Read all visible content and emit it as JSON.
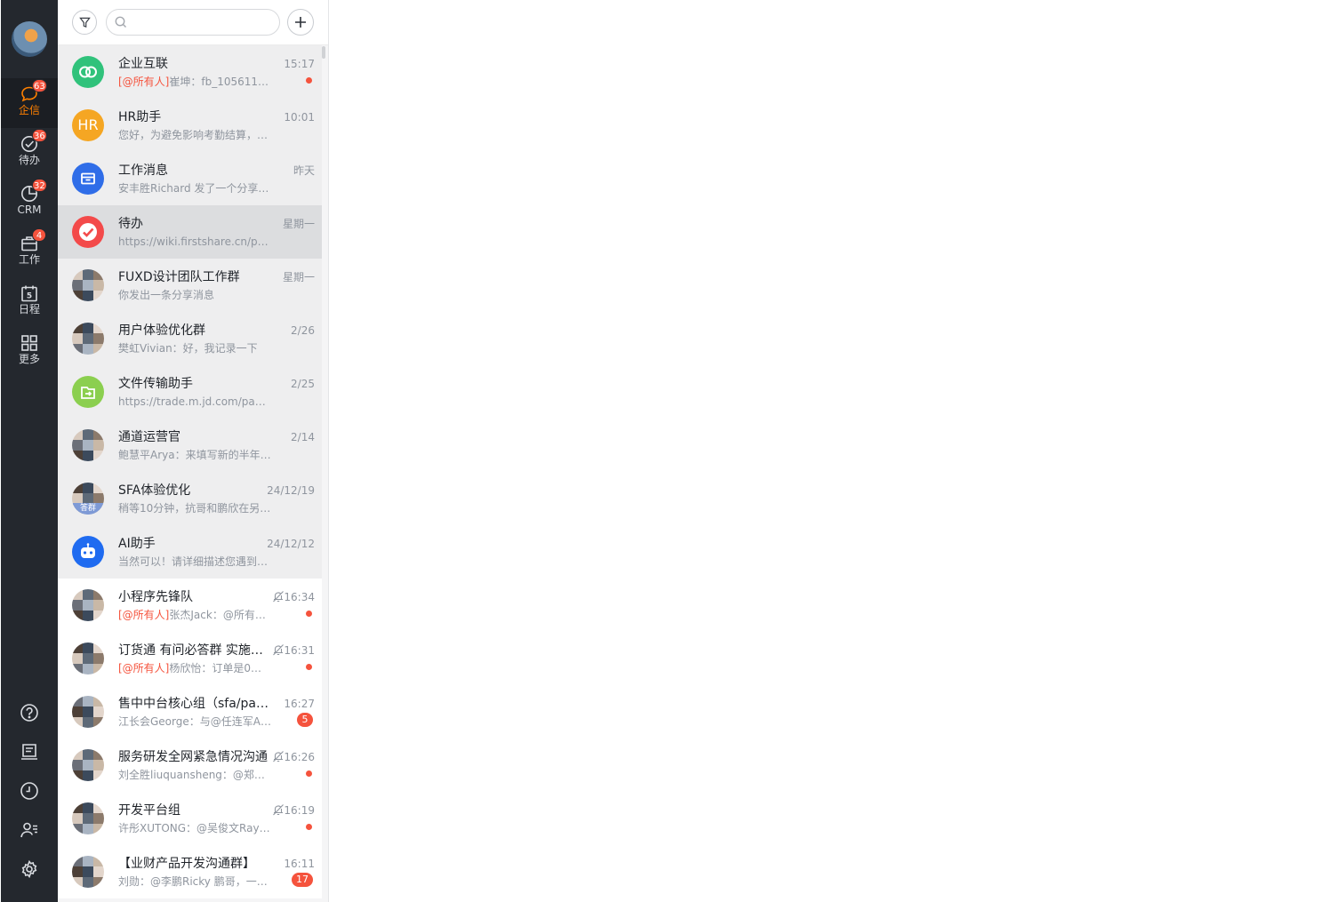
{
  "nav": {
    "items": [
      {
        "label": "企信",
        "badge": "63",
        "icon": "chat-bubble-icon",
        "active": true
      },
      {
        "label": "待办",
        "badge": "36",
        "icon": "check-circle-icon",
        "active": false
      },
      {
        "label": "CRM",
        "badge": "32",
        "icon": "pie-chart-icon",
        "active": false
      },
      {
        "label": "工作",
        "badge": "4",
        "icon": "briefcase-icon",
        "active": false
      },
      {
        "label": "日程",
        "badge": "",
        "icon": "calendar-icon",
        "active": false
      },
      {
        "label": "更多",
        "badge": "",
        "icon": "grid-icon",
        "active": false
      }
    ],
    "calendar_day": "5",
    "bottom_icons": [
      "help-icon",
      "notes-icon",
      "clock-icon",
      "contacts-icon",
      "settings-icon"
    ]
  },
  "search": {
    "placeholder": ""
  },
  "conversations": [
    {
      "name": "企业互联",
      "mention": "[@所有人]",
      "preview": "崔坤：fb_105611…",
      "time": "15:17",
      "dot": true,
      "count": "",
      "muted": false,
      "pinned": true,
      "avatar": "interconnect-icon"
    },
    {
      "name": "HR助手",
      "mention": "",
      "preview": "您好，为避免影响考勤结算，…",
      "time": "10:01",
      "dot": false,
      "count": "",
      "muted": false,
      "pinned": true,
      "avatar_text": "HR"
    },
    {
      "name": "工作消息",
      "mention": "",
      "preview": "安丰胜Richard 发了一个分享…",
      "time": "昨天",
      "dot": false,
      "count": "",
      "muted": false,
      "pinned": true,
      "avatar": "work-message-icon"
    },
    {
      "name": "待办",
      "mention": "",
      "preview": "https://wiki.firstshare.cn/page…",
      "time": "星期一",
      "dot": false,
      "count": "",
      "muted": false,
      "pinned": true,
      "selected": true,
      "avatar": "todo-check-icon"
    },
    {
      "name": "FUXD设计团队工作群",
      "mention": "",
      "preview": "你发出一条分享消息",
      "time": "星期一",
      "dot": false,
      "count": "",
      "muted": false,
      "pinned": true,
      "avatar": "group-mosaic"
    },
    {
      "name": "用户体验优化群",
      "mention": "",
      "preview": "樊虹Vivian：好，我记录一下",
      "time": "2/26",
      "dot": false,
      "count": "",
      "muted": false,
      "pinned": true,
      "avatar": "group-mosaic"
    },
    {
      "name": "文件传输助手",
      "mention": "",
      "preview": "https://trade.m.jd.com/pay?co…",
      "time": "2/25",
      "dot": false,
      "count": "",
      "muted": false,
      "pinned": true,
      "avatar": "file-transfer-icon"
    },
    {
      "name": "通道运营官",
      "mention": "",
      "preview": "鲍慧平Arya：来填写新的半年…",
      "time": "2/14",
      "dot": false,
      "count": "",
      "muted": false,
      "pinned": true,
      "avatar": "group-mosaic"
    },
    {
      "name": "SFA体验优化",
      "mention": "",
      "preview": "稍等10分钟，抗哥和鹏欣在另…",
      "time": "24/12/19",
      "dot": false,
      "count": "",
      "muted": false,
      "pinned": true,
      "avatar": "group-mosaic",
      "avatar_tag": "答群"
    },
    {
      "name": "AI助手",
      "mention": "",
      "preview": "当然可以！请详细描述您遇到…",
      "time": "24/12/12",
      "dot": false,
      "count": "",
      "muted": false,
      "pinned": true,
      "avatar": "robot-icon"
    },
    {
      "name": "小程序先锋队",
      "mention": "[@所有人]",
      "preview": "张杰Jack：@所有…",
      "time": "16:34",
      "dot": true,
      "count": "",
      "muted": true,
      "pinned": false,
      "avatar": "group-mosaic"
    },
    {
      "name": "订货通 有问必答群 实施…",
      "mention": "[@所有人]",
      "preview": "杨欣怡：订单是0元…",
      "time": "16:31",
      "dot": true,
      "count": "",
      "muted": true,
      "pinned": false,
      "avatar": "group-mosaic"
    },
    {
      "name": "售中中台核心组（sfa/paas/…",
      "mention": "",
      "preview": "江长会George：与@任连军A…",
      "time": "16:27",
      "dot": false,
      "count": "5",
      "muted": false,
      "pinned": false,
      "avatar": "group-mosaic"
    },
    {
      "name": "服务研发全网紧急情况沟通",
      "mention": "",
      "preview": "刘全胜liuquansheng：@郑磊…",
      "time": "16:26",
      "dot": true,
      "count": "",
      "muted": true,
      "pinned": false,
      "avatar": "group-mosaic"
    },
    {
      "name": "开发平台组",
      "mention": "",
      "preview": "许彤XUTONG：@吴俊文Ray…",
      "time": "16:19",
      "dot": true,
      "count": "",
      "muted": true,
      "pinned": false,
      "avatar": "group-mosaic"
    },
    {
      "name": "【业财产品开发沟通群】",
      "mention": "",
      "preview": "刘勋：@李鹏Ricky 鹏哥，一…",
      "time": "16:11",
      "dot": false,
      "count": "17",
      "muted": false,
      "pinned": false,
      "avatar": "group-mosaic"
    }
  ],
  "colors": {
    "nav_bg": "#24282e",
    "accent": "#ff8000",
    "badge": "#f5533d"
  }
}
